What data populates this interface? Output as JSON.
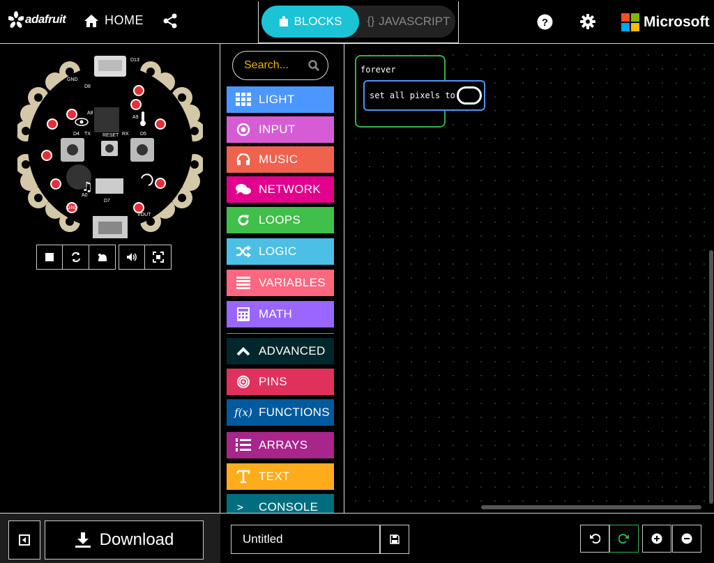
{
  "header": {
    "logo_text": "adafruit",
    "home_label": "HOME",
    "blocks_label": "BLOCKS",
    "javascript_label": "JAVASCRIPT",
    "javascript_prefix": "{}",
    "brand_label": "Microsoft"
  },
  "toolbox": {
    "search_placeholder": "Search...",
    "categories": [
      {
        "label": "LIGHT",
        "color": "#4c97ff",
        "icon": "grid-icon"
      },
      {
        "label": "INPUT",
        "color": "#d65cd6",
        "icon": "target-icon"
      },
      {
        "label": "MUSIC",
        "color": "#f0624e",
        "icon": "headphones-icon"
      },
      {
        "label": "NETWORK",
        "color": "#e3008c",
        "icon": "chat-icon"
      },
      {
        "label": "LOOPS",
        "color": "#40bf4a",
        "icon": "refresh-icon"
      },
      {
        "label": "LOGIC",
        "color": "#4cbfe6",
        "icon": "shuffle-icon"
      },
      {
        "label": "VARIABLES",
        "color": "#ff6680",
        "icon": "list-icon"
      },
      {
        "label": "MATH",
        "color": "#9966ff",
        "icon": "calculator-icon"
      },
      {
        "label": "ADVANCED",
        "color": "#00272b",
        "icon": "chevron-up-icon"
      },
      {
        "label": "PINS",
        "color": "#e0315d",
        "icon": "pin-icon"
      },
      {
        "label": "FUNCTIONS",
        "color": "#005a9e",
        "icon": "function-icon"
      },
      {
        "label": "ARRAYS",
        "color": "#a8258c",
        "icon": "array-icon"
      },
      {
        "label": "TEXT",
        "color": "#ffac1c",
        "icon": "text-icon"
      },
      {
        "label": "CONSOLE",
        "color": "#006e7e",
        "icon": "console-icon"
      }
    ]
  },
  "workspace": {
    "forever_label": "forever",
    "pixels_label": "set all pixels to"
  },
  "footer": {
    "download_label": "Download",
    "project_name": "Untitled"
  },
  "colors": {
    "accent": "#1bc3d6",
    "search_text": "#f0b400",
    "loops": "#2fb34a",
    "light": "#4c97ff"
  }
}
